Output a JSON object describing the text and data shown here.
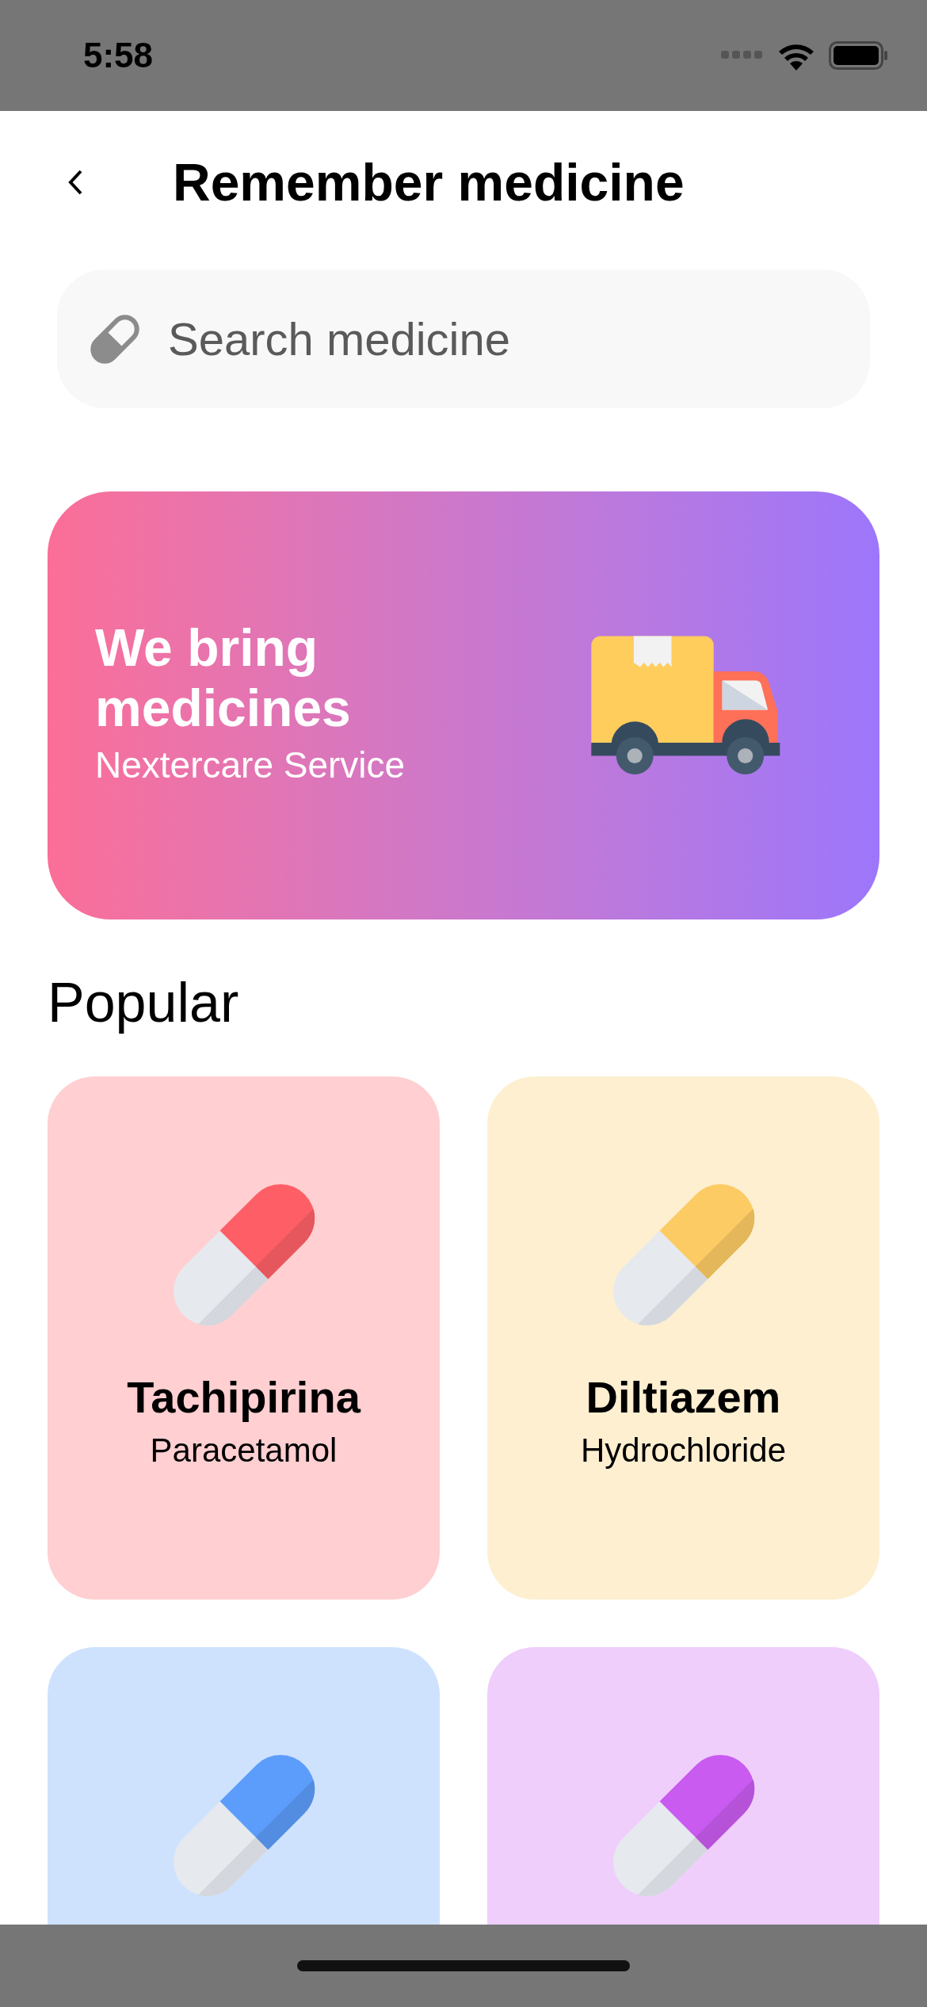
{
  "status_bar": {
    "time": "5:58"
  },
  "header": {
    "title": "Remember medicine"
  },
  "search": {
    "placeholder": "Search medicine"
  },
  "banner": {
    "title": "We bring medicines",
    "subtitle": "Nextercare Service"
  },
  "section": {
    "title": "Popular"
  },
  "medicines": [
    {
      "name": "Tachipirina",
      "detail": "Paracetamol",
      "color": "#fe5f67"
    },
    {
      "name": "Diltiazem",
      "detail": "Hydrochloride",
      "color": "#fccb64"
    },
    {
      "color": "#5c9dfb"
    },
    {
      "color": "#c95bf0"
    }
  ]
}
